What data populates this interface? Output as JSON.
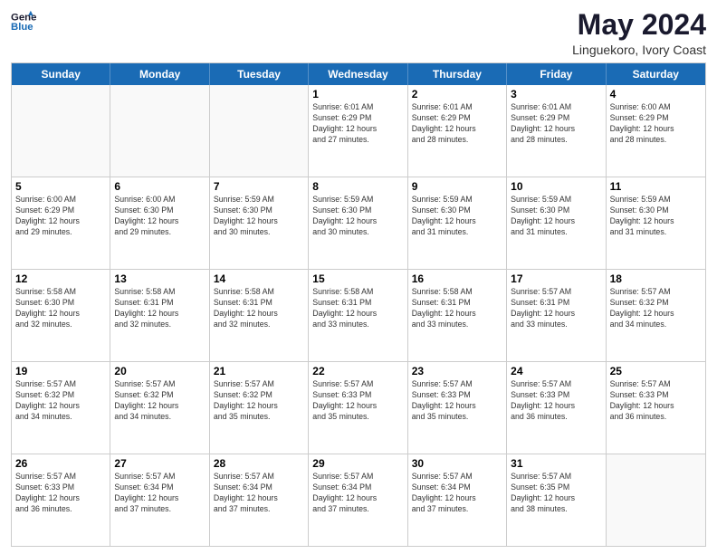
{
  "header": {
    "logo_line1": "General",
    "logo_line2": "Blue",
    "month_year": "May 2024",
    "location": "Linguekoro, Ivory Coast"
  },
  "weekdays": [
    "Sunday",
    "Monday",
    "Tuesday",
    "Wednesday",
    "Thursday",
    "Friday",
    "Saturday"
  ],
  "rows": [
    [
      {
        "day": "",
        "info": ""
      },
      {
        "day": "",
        "info": ""
      },
      {
        "day": "",
        "info": ""
      },
      {
        "day": "1",
        "info": "Sunrise: 6:01 AM\nSunset: 6:29 PM\nDaylight: 12 hours\nand 27 minutes."
      },
      {
        "day": "2",
        "info": "Sunrise: 6:01 AM\nSunset: 6:29 PM\nDaylight: 12 hours\nand 28 minutes."
      },
      {
        "day": "3",
        "info": "Sunrise: 6:01 AM\nSunset: 6:29 PM\nDaylight: 12 hours\nand 28 minutes."
      },
      {
        "day": "4",
        "info": "Sunrise: 6:00 AM\nSunset: 6:29 PM\nDaylight: 12 hours\nand 28 minutes."
      }
    ],
    [
      {
        "day": "5",
        "info": "Sunrise: 6:00 AM\nSunset: 6:29 PM\nDaylight: 12 hours\nand 29 minutes."
      },
      {
        "day": "6",
        "info": "Sunrise: 6:00 AM\nSunset: 6:30 PM\nDaylight: 12 hours\nand 29 minutes."
      },
      {
        "day": "7",
        "info": "Sunrise: 5:59 AM\nSunset: 6:30 PM\nDaylight: 12 hours\nand 30 minutes."
      },
      {
        "day": "8",
        "info": "Sunrise: 5:59 AM\nSunset: 6:30 PM\nDaylight: 12 hours\nand 30 minutes."
      },
      {
        "day": "9",
        "info": "Sunrise: 5:59 AM\nSunset: 6:30 PM\nDaylight: 12 hours\nand 31 minutes."
      },
      {
        "day": "10",
        "info": "Sunrise: 5:59 AM\nSunset: 6:30 PM\nDaylight: 12 hours\nand 31 minutes."
      },
      {
        "day": "11",
        "info": "Sunrise: 5:59 AM\nSunset: 6:30 PM\nDaylight: 12 hours\nand 31 minutes."
      }
    ],
    [
      {
        "day": "12",
        "info": "Sunrise: 5:58 AM\nSunset: 6:30 PM\nDaylight: 12 hours\nand 32 minutes."
      },
      {
        "day": "13",
        "info": "Sunrise: 5:58 AM\nSunset: 6:31 PM\nDaylight: 12 hours\nand 32 minutes."
      },
      {
        "day": "14",
        "info": "Sunrise: 5:58 AM\nSunset: 6:31 PM\nDaylight: 12 hours\nand 32 minutes."
      },
      {
        "day": "15",
        "info": "Sunrise: 5:58 AM\nSunset: 6:31 PM\nDaylight: 12 hours\nand 33 minutes."
      },
      {
        "day": "16",
        "info": "Sunrise: 5:58 AM\nSunset: 6:31 PM\nDaylight: 12 hours\nand 33 minutes."
      },
      {
        "day": "17",
        "info": "Sunrise: 5:57 AM\nSunset: 6:31 PM\nDaylight: 12 hours\nand 33 minutes."
      },
      {
        "day": "18",
        "info": "Sunrise: 5:57 AM\nSunset: 6:32 PM\nDaylight: 12 hours\nand 34 minutes."
      }
    ],
    [
      {
        "day": "19",
        "info": "Sunrise: 5:57 AM\nSunset: 6:32 PM\nDaylight: 12 hours\nand 34 minutes."
      },
      {
        "day": "20",
        "info": "Sunrise: 5:57 AM\nSunset: 6:32 PM\nDaylight: 12 hours\nand 34 minutes."
      },
      {
        "day": "21",
        "info": "Sunrise: 5:57 AM\nSunset: 6:32 PM\nDaylight: 12 hours\nand 35 minutes."
      },
      {
        "day": "22",
        "info": "Sunrise: 5:57 AM\nSunset: 6:33 PM\nDaylight: 12 hours\nand 35 minutes."
      },
      {
        "day": "23",
        "info": "Sunrise: 5:57 AM\nSunset: 6:33 PM\nDaylight: 12 hours\nand 35 minutes."
      },
      {
        "day": "24",
        "info": "Sunrise: 5:57 AM\nSunset: 6:33 PM\nDaylight: 12 hours\nand 36 minutes."
      },
      {
        "day": "25",
        "info": "Sunrise: 5:57 AM\nSunset: 6:33 PM\nDaylight: 12 hours\nand 36 minutes."
      }
    ],
    [
      {
        "day": "26",
        "info": "Sunrise: 5:57 AM\nSunset: 6:33 PM\nDaylight: 12 hours\nand 36 minutes."
      },
      {
        "day": "27",
        "info": "Sunrise: 5:57 AM\nSunset: 6:34 PM\nDaylight: 12 hours\nand 37 minutes."
      },
      {
        "day": "28",
        "info": "Sunrise: 5:57 AM\nSunset: 6:34 PM\nDaylight: 12 hours\nand 37 minutes."
      },
      {
        "day": "29",
        "info": "Sunrise: 5:57 AM\nSunset: 6:34 PM\nDaylight: 12 hours\nand 37 minutes."
      },
      {
        "day": "30",
        "info": "Sunrise: 5:57 AM\nSunset: 6:34 PM\nDaylight: 12 hours\nand 37 minutes."
      },
      {
        "day": "31",
        "info": "Sunrise: 5:57 AM\nSunset: 6:35 PM\nDaylight: 12 hours\nand 38 minutes."
      },
      {
        "day": "",
        "info": ""
      }
    ]
  ]
}
